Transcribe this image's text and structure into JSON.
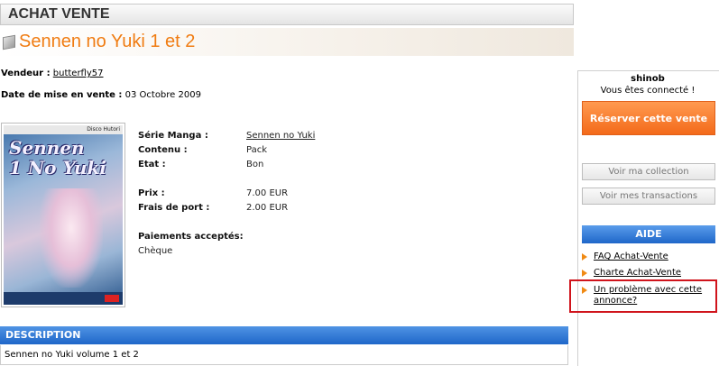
{
  "header": {
    "section_title": "ACHAT VENTE"
  },
  "listing": {
    "title": "Sennen no Yuki 1 et 2",
    "seller_label": "Vendeur :",
    "seller_name": "butterfly57",
    "date_label": "Date de mise en vente :",
    "date_value": "03 Octobre 2009"
  },
  "cover": {
    "author": "Disco Hutori",
    "title_line1": "Sennen",
    "title_line2": "No Yuki",
    "volume": "1"
  },
  "details": {
    "serie_label": "Série Manga :",
    "serie_value": "Sennen no Yuki",
    "contenu_label": "Contenu :",
    "contenu_value": "Pack",
    "etat_label": "Etat :",
    "etat_value": "Bon",
    "prix_label": "Prix :",
    "prix_value": "7.00 EUR",
    "port_label": "Frais de port :",
    "port_value": "2.00 EUR",
    "paiements_label": "Paiements acceptés:",
    "paiements_value": "Chèque"
  },
  "description": {
    "header": "DESCRIPTION",
    "text": "Sennen no Yuki volume 1 et 2"
  },
  "sidebar": {
    "username": "shinob",
    "status": "Vous êtes connecté !",
    "reserve_button": "Réserver cette vente",
    "collection_button": "Voir ma collection",
    "transactions_button": "Voir mes transactions",
    "aide_header": "AIDE",
    "links": [
      "FAQ Achat-Vente",
      "Charte Achat-Vente",
      "Un problème avec cette annonce?"
    ]
  },
  "colors": {
    "accent_orange": "#f07c12",
    "header_blue": "#1f67c9",
    "highlight_red": "#d0141c"
  }
}
